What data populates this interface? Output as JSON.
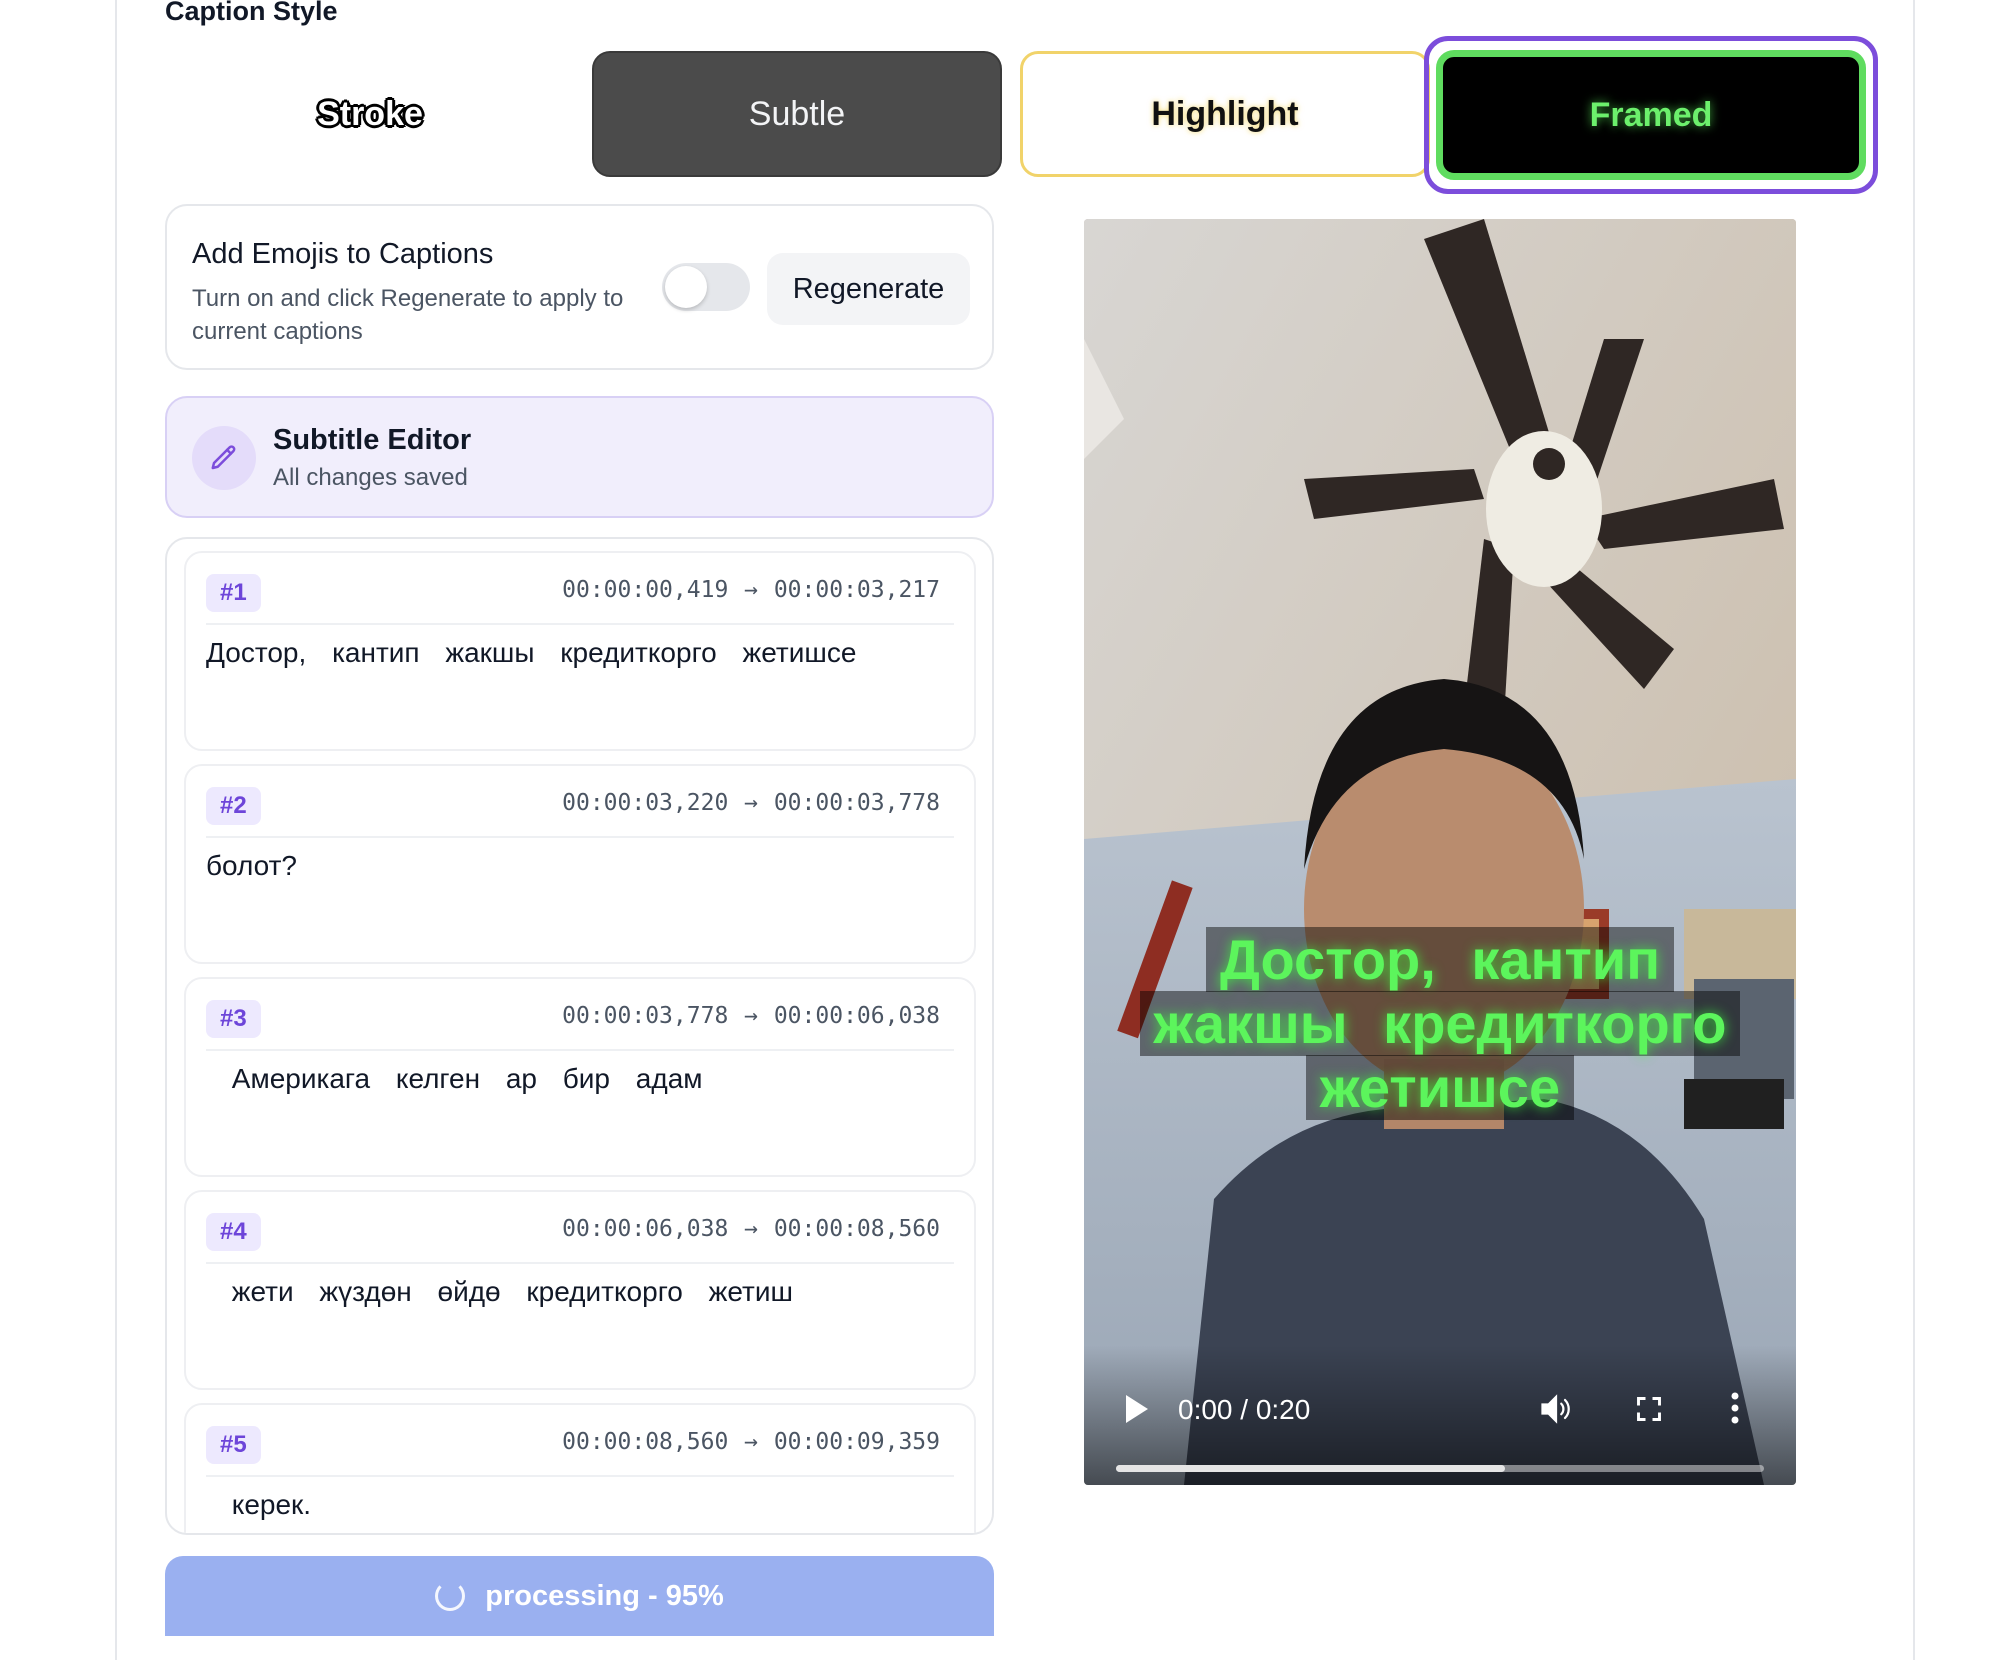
{
  "caption_style": {
    "title": "Caption Style",
    "options": [
      {
        "label": "Stroke"
      },
      {
        "label": "Subtle"
      },
      {
        "label": "Highlight"
      },
      {
        "label": "Framed",
        "selected": true
      }
    ]
  },
  "emoji_card": {
    "title": "Add Emojis to Captions",
    "description": "Turn on and click Regenerate to apply to current captions",
    "toggle_on": false,
    "regenerate_label": "Regenerate"
  },
  "editor": {
    "title": "Subtitle Editor",
    "status": "All changes saved"
  },
  "subtitles": [
    {
      "index": "#1",
      "time": "00:00:00,419 → 00:00:03,217",
      "text": "Достор, кантип жакшы кредиткорго жетишсе"
    },
    {
      "index": "#2",
      "time": "00:00:03,220 → 00:00:03,778",
      "text": "болот?"
    },
    {
      "index": "#3",
      "time": "00:00:03,778 → 00:00:06,038",
      "text": " Америкага келген ар бир адам"
    },
    {
      "index": "#4",
      "time": "00:00:06,038 → 00:00:08,560",
      "text": " жети жүздөн өйдө кредиткорго жетиш"
    },
    {
      "index": "#5",
      "time": "00:00:08,560 → 00:00:09,359",
      "text": " керек."
    }
  ],
  "processing": {
    "label": "processing - 95%",
    "progress": 0.95
  },
  "video": {
    "caption_lines": [
      "Достор, кантип",
      "жакшы кредиткорго",
      "жетишсе"
    ],
    "time": "0:00 / 0:20",
    "progress": 0.6,
    "caption_color": "#5cf55c"
  },
  "colors": {
    "accent": "#7c4ddb",
    "framed_green": "#5fdc5f",
    "highlight_yellow": "#f1d36a"
  }
}
